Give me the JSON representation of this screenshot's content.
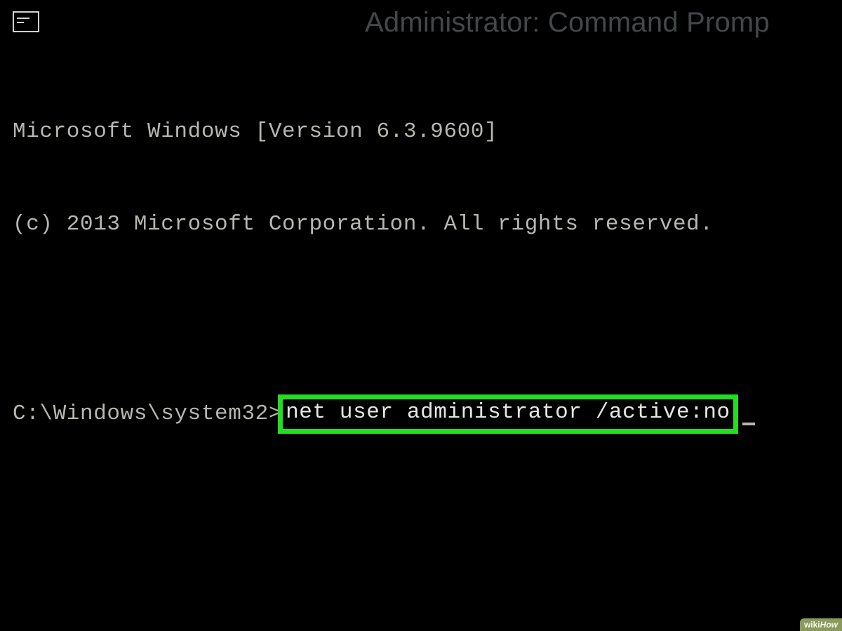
{
  "window": {
    "title": "Administrator: Command Promp"
  },
  "terminal": {
    "version_line": "Microsoft Windows [Version 6.3.9600]",
    "copyright_line": "(c) 2013 Microsoft Corporation. All rights reserved.",
    "prompt": "C:\\Windows\\system32>",
    "command": "net user administrator /active:no"
  },
  "watermark": {
    "brand_prefix": "wiki",
    "brand_suffix": "How"
  }
}
